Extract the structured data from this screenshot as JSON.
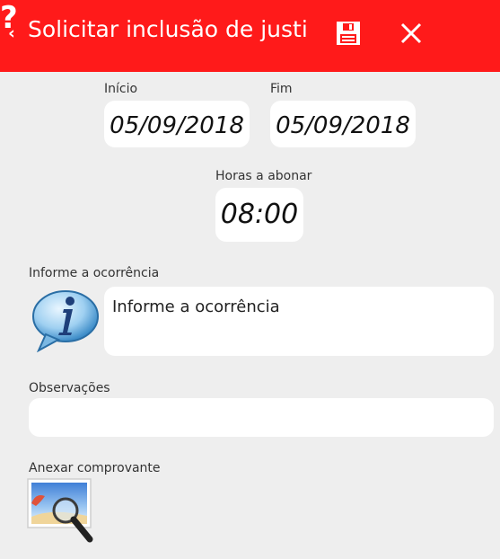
{
  "header": {
    "title": "Solicitar inclusão de justific…",
    "back_icon": "chevron-left-icon",
    "save_icon": "save-icon",
    "close_icon": "close-icon",
    "help_label": "?",
    "background_color": "#ff1a1a"
  },
  "dates": {
    "inicio_label": "Início",
    "inicio_value": "05/09/2018",
    "fim_label": "Fim",
    "fim_value": "05/09/2018"
  },
  "hours": {
    "label": "Horas a abonar",
    "value": "08:00"
  },
  "occurrence": {
    "label": "Informe a ocorrência",
    "value": "Informe a ocorrência",
    "icon": "info-bubble-icon"
  },
  "observations": {
    "label": "Observações",
    "value": ""
  },
  "attachment": {
    "label": "Anexar comprovante",
    "icon": "image-search-icon"
  }
}
